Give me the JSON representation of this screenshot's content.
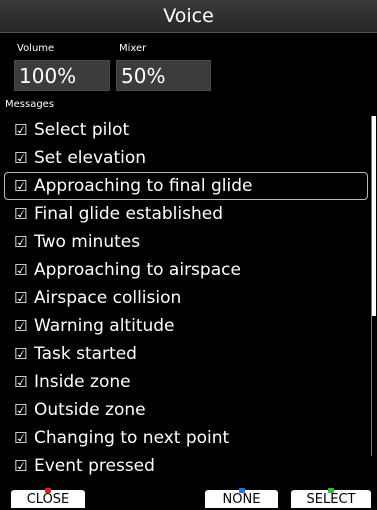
{
  "header": {
    "title": "Voice"
  },
  "volume": {
    "label": "Volume",
    "value": "100%"
  },
  "mixer": {
    "label": "Mixer",
    "value": "50%"
  },
  "messages": {
    "label": "Messages",
    "check_glyph": "☑",
    "items": [
      {
        "label": "Select pilot",
        "checked": true
      },
      {
        "label": "Set elevation",
        "checked": true
      },
      {
        "label": "Approaching to final glide",
        "checked": true,
        "selected": true
      },
      {
        "label": "Final glide established",
        "checked": true
      },
      {
        "label": "Two minutes",
        "checked": true
      },
      {
        "label": "Approaching to airspace",
        "checked": true
      },
      {
        "label": "Airspace collision",
        "checked": true
      },
      {
        "label": "Warning altitude",
        "checked": true
      },
      {
        "label": "Task started",
        "checked": true
      },
      {
        "label": "Inside zone",
        "checked": true
      },
      {
        "label": "Outside zone",
        "checked": true
      },
      {
        "label": "Changing to next point",
        "checked": true
      },
      {
        "label": "Event pressed",
        "checked": true
      }
    ]
  },
  "softkeys": {
    "close": {
      "label": "CLOSE",
      "color": "#e02020"
    },
    "none": {
      "label": "NONE",
      "color": "#2a6fe0"
    },
    "select": {
      "label": "SELECT",
      "color": "#2fbf2f"
    }
  },
  "colors": {
    "background": "#000000",
    "title_bar": "#2e2e2e",
    "value_box": "#3c3c3c",
    "selection_border": "#b8b8b8"
  }
}
